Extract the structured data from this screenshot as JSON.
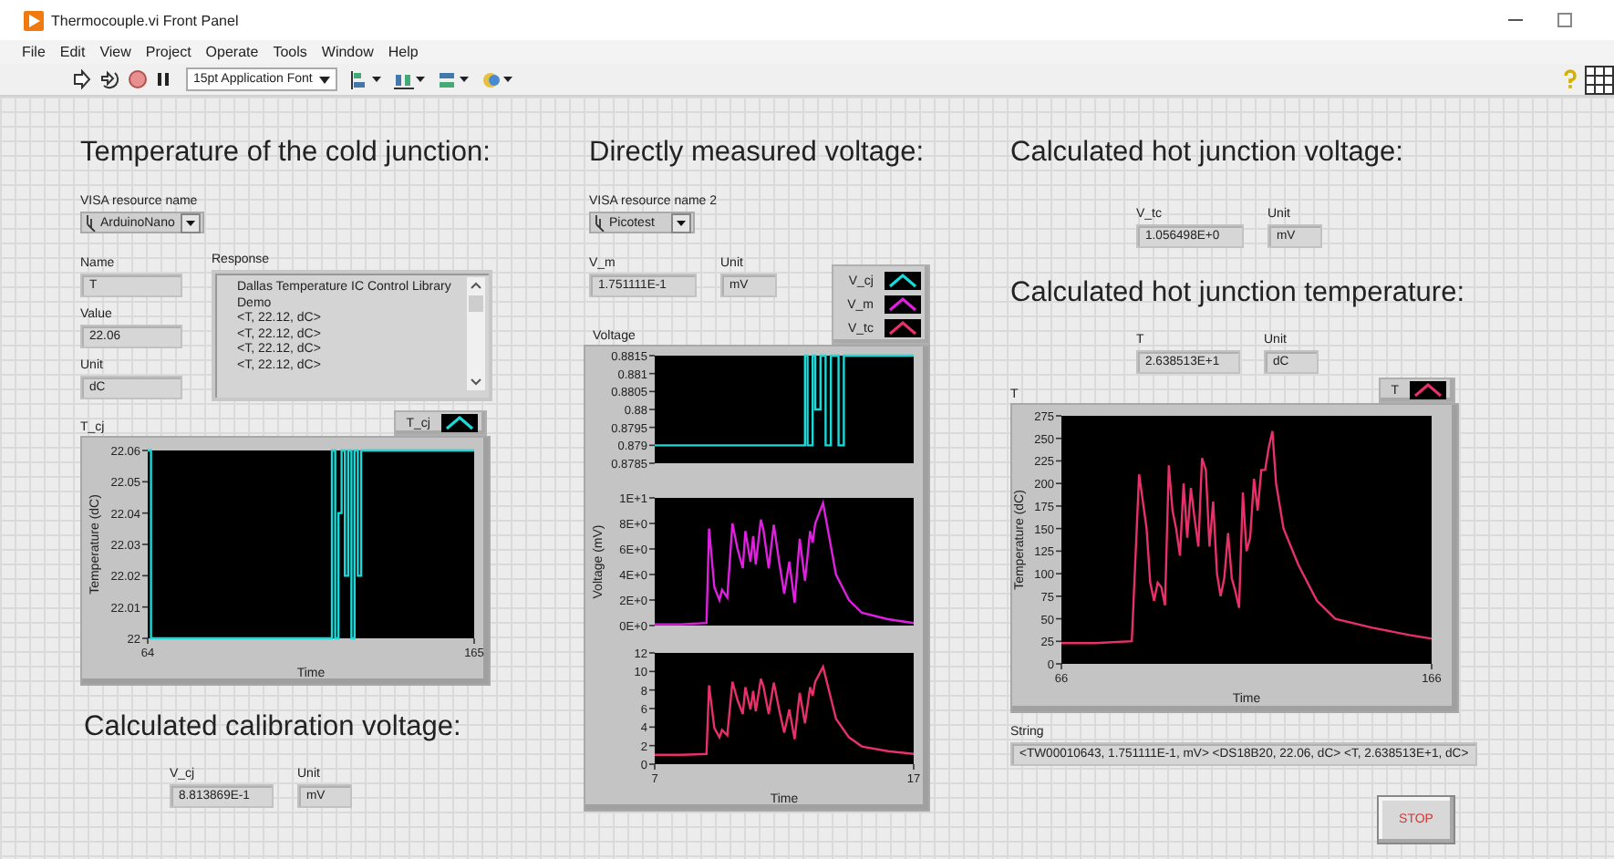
{
  "window": {
    "title": "Thermocouple.vi Front Panel"
  },
  "menu": [
    "File",
    "Edit",
    "View",
    "Project",
    "Operate",
    "Tools",
    "Window",
    "Help"
  ],
  "toolbar": {
    "font": "15pt Application Font"
  },
  "cold_junction": {
    "heading": "Temperature of the cold junction:",
    "visa": {
      "label": "VISA resource name",
      "value": "ArduinoNano"
    },
    "fields": [
      {
        "label": "Name",
        "value": "T"
      },
      {
        "label": "Value",
        "value": "22.06"
      },
      {
        "label": "Unit",
        "value": "dC"
      }
    ],
    "response": {
      "label": "Response",
      "lines": [
        "Dallas Temperature IC Control Library",
        "Demo",
        "<T, 22.12, dC>",
        "<T, 22.12, dC>",
        "<T, 22.12, dC>",
        "<T, 22.12, dC>"
      ]
    },
    "graph": {
      "label": "T_cj",
      "chart_data": {
        "type": "line",
        "xlabel": "Time",
        "ylabel": "Temperature (dC)",
        "xlim": [
          64,
          165
        ],
        "ylim": [
          22,
          22.06
        ],
        "xticks": [
          64,
          165
        ],
        "yticks": [
          22,
          22.01,
          22.02,
          22.03,
          22.04,
          22.05,
          22.06
        ],
        "x": [
          64,
          65,
          65,
          121,
          121,
          122,
          122,
          123,
          123,
          124,
          124,
          125,
          125,
          126,
          126,
          127,
          127,
          128,
          128,
          129,
          129,
          130,
          130,
          165
        ],
        "series": [
          {
            "name": "T_cj",
            "color": "#19d9d9",
            "values": [
              22.06,
              22.06,
              22,
              22,
              22.06,
              22.06,
              22,
              22,
              22.04,
              22.04,
              22.06,
              22.06,
              22.02,
              22.02,
              22.06,
              22.06,
              22,
              22,
              22.06,
              22.06,
              22.02,
              22.02,
              22.06,
              22.06
            ]
          }
        ]
      }
    }
  },
  "calibration": {
    "heading": "Calculated calibration voltage:",
    "fields": [
      {
        "label": "V_cj",
        "value": "8.813869E-1"
      },
      {
        "label": "Unit",
        "value": "mV"
      }
    ]
  },
  "measured": {
    "heading": "Directly measured voltage:",
    "visa": {
      "label": "VISA resource name 2",
      "value": "Picotest"
    },
    "fields": [
      {
        "label": "V_m",
        "value": "1.751111E-1"
      },
      {
        "label": "Unit",
        "value": "mV"
      }
    ],
    "graph": {
      "label": "Voltage",
      "plots": [
        {
          "chart_data": {
            "type": "line",
            "xlim": [
              7,
              17
            ],
            "ylim": [
              0.8785,
              0.8815
            ],
            "yticks": [
              0.8785,
              0.879,
              0.8795,
              0.88,
              0.8805,
              0.881,
              0.8815
            ],
            "x": [
              7,
              12.8,
              12.8,
              12.9,
              12.9,
              13.1,
              13.1,
              13.2,
              13.2,
              13.4,
              13.4,
              13.6,
              13.6,
              13.8,
              13.8,
              14.1,
              14.1,
              14.3,
              14.3,
              14.5,
              14.5,
              17
            ],
            "series": [
              {
                "name": "V_cj",
                "color": "#19d9d9",
                "values": [
                  0.879,
                  0.879,
                  0.8815,
                  0.8815,
                  0.879,
                  0.879,
                  0.8815,
                  0.8815,
                  0.88,
                  0.88,
                  0.8815,
                  0.8815,
                  0.879,
                  0.879,
                  0.8815,
                  0.8815,
                  0.879,
                  0.879,
                  0.8815,
                  0.8815,
                  0.8815,
                  0.8815
                ]
              }
            ]
          }
        },
        {
          "chart_data": {
            "type": "line",
            "ylabel": "Voltage (mV)",
            "xlim": [
              7,
              17
            ],
            "ylim": [
              0,
              10
            ],
            "yticks": [
              {
                "value": 0,
                "label": "0E+0"
              },
              {
                "value": 2,
                "label": "2E+0"
              },
              {
                "value": 4,
                "label": "4E+0"
              },
              {
                "value": 6,
                "label": "6E+0"
              },
              {
                "value": 8,
                "label": "8E+0"
              },
              {
                "value": 10,
                "label": "1E+1"
              }
            ],
            "x": [
              7,
              8,
              9,
              9.1,
              9.3,
              9.5,
              9.6,
              9.8,
              10,
              10.2,
              10.4,
              10.5,
              10.7,
              10.8,
              10.9,
              11.1,
              11.2,
              11.4,
              11.6,
              11.8,
              12,
              12.2,
              12.4,
              12.6,
              12.8,
              13,
              13.1,
              13.2,
              13.5,
              14,
              14.5,
              15,
              16,
              17
            ],
            "series": [
              {
                "name": "V_m",
                "color": "#e020e0",
                "values": [
                  0.1,
                  0.1,
                  0.2,
                  7.6,
                  3,
                  2,
                  2.8,
                  2.2,
                  8,
                  6,
                  4.5,
                  7.4,
                  5,
                  7,
                  4.8,
                  8.3,
                  7.5,
                  4.5,
                  7.9,
                  5,
                  2.5,
                  5,
                  1.8,
                  6.8,
                  3.5,
                  7.4,
                  6.5,
                  8,
                  9.6,
                  4,
                  2,
                  1,
                  0.5,
                  0.2
                ]
              }
            ]
          }
        },
        {
          "chart_data": {
            "type": "line",
            "xlabel": "Time",
            "xlim": [
              7,
              17
            ],
            "ylim": [
              0,
              12
            ],
            "xticks": [
              7,
              17
            ],
            "yticks": [
              0,
              2,
              4,
              6,
              8,
              10,
              12
            ],
            "x": [
              7,
              8,
              9,
              9.1,
              9.3,
              9.5,
              9.6,
              9.8,
              10,
              10.2,
              10.4,
              10.5,
              10.7,
              10.8,
              10.9,
              11.1,
              11.2,
              11.4,
              11.6,
              11.8,
              12,
              12.2,
              12.4,
              12.6,
              12.8,
              13,
              13.1,
              13.2,
              13.5,
              14,
              14.5,
              15,
              16,
              17
            ],
            "series": [
              {
                "name": "V_tc",
                "color": "#e8306a",
                "values": [
                  1,
                  1,
                  1.1,
                  8.5,
                  3.9,
                  2.9,
                  3.7,
                  3.1,
                  8.9,
                  6.9,
                  5.4,
                  8.3,
                  5.9,
                  7.9,
                  5.7,
                  9.2,
                  8.4,
                  5.4,
                  8.8,
                  5.9,
                  3.4,
                  5.9,
                  2.7,
                  7.7,
                  4.4,
                  8.3,
                  7.4,
                  8.9,
                  10.5,
                  4.9,
                  2.9,
                  1.9,
                  1.4,
                  1.1
                ]
              }
            ]
          }
        }
      ]
    }
  },
  "hot_voltage": {
    "heading": "Calculated hot junction voltage:",
    "fields": [
      {
        "label": "V_tc",
        "value": "1.056498E+0"
      },
      {
        "label": "Unit",
        "value": "mV"
      }
    ]
  },
  "hot_temperature": {
    "heading": "Calculated hot junction temperature:",
    "fields": [
      {
        "label": "T",
        "value": "2.638513E+1"
      },
      {
        "label": "Unit",
        "value": "dC"
      }
    ],
    "graph": {
      "label": "T",
      "chart_data": {
        "type": "line",
        "xlabel": "Time",
        "ylabel": "Temperature (dC)",
        "xlim": [
          66,
          166
        ],
        "ylim": [
          0,
          275
        ],
        "xticks": [
          66,
          166
        ],
        "yticks": [
          0,
          25,
          50,
          75,
          100,
          125,
          150,
          175,
          200,
          225,
          250,
          275
        ],
        "x": [
          66,
          75,
          85,
          87,
          89,
          90,
          91,
          92,
          93,
          94,
          95,
          96,
          97,
          98,
          99,
          100,
          101,
          102,
          103,
          104,
          105,
          106,
          107,
          108,
          109,
          110,
          111,
          112,
          113,
          114,
          115,
          116,
          117,
          118,
          119,
          120,
          121,
          122,
          123,
          124,
          126,
          130,
          135,
          140,
          150,
          160,
          166
        ],
        "series": [
          {
            "name": "T",
            "color": "#e8306a",
            "values": [
              23,
              23,
              25,
              210,
              150,
              90,
              70,
              90,
              85,
              65,
              220,
              170,
              150,
              120,
              200,
              140,
              195,
              160,
              130,
              228,
              215,
              130,
              180,
              100,
              75,
              95,
              145,
              95,
              80,
              62,
              190,
              125,
              140,
              205,
              170,
              215,
              215,
              240,
              258,
              200,
              150,
              110,
              70,
              50,
              40,
              32,
              28
            ]
          }
        ]
      }
    },
    "string": {
      "label": "String",
      "value": "<TW00010643, 1.751111E-1, mV> <DS18B20,  22.06,  dC> <T, 2.638513E+1, dC>"
    }
  },
  "stop_button": "STOP"
}
